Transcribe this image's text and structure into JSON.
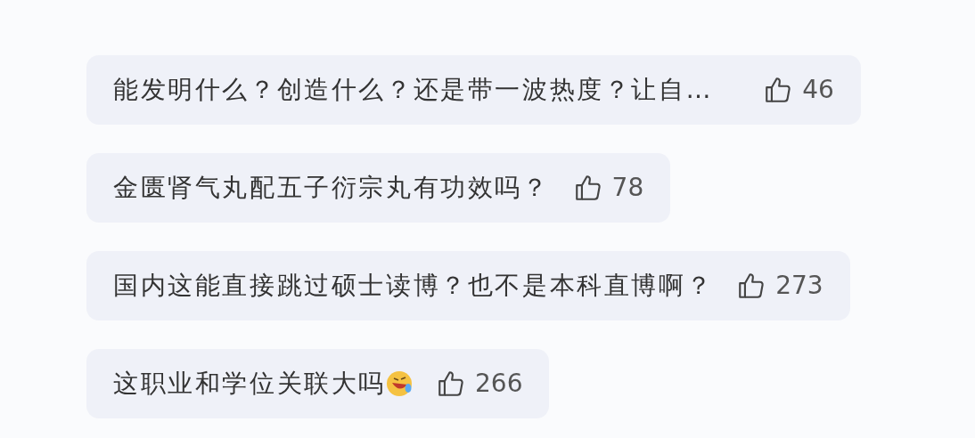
{
  "questions": [
    {
      "text": "能发明什么？创造什么？还是带一波热度？让自…",
      "emoji": false,
      "likes": "46"
    },
    {
      "text": "金匮肾气丸配五子衍宗丸有功效吗？",
      "emoji": false,
      "likes": "78"
    },
    {
      "text": "国内这能直接跳过硕士读博？也不是本科直博啊？",
      "emoji": false,
      "likes": "273"
    },
    {
      "text": "这职业和学位关联大吗",
      "emoji": true,
      "likes": "266"
    }
  ]
}
